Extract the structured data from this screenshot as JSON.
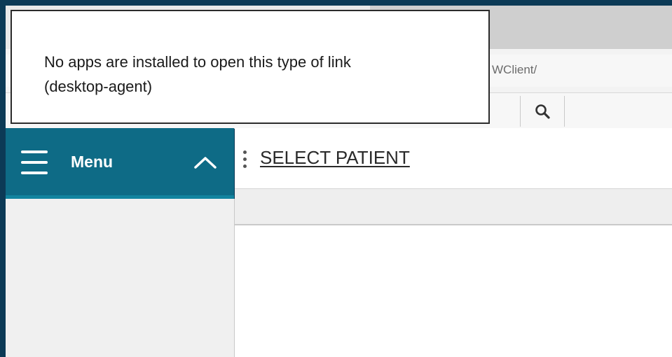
{
  "browser": {
    "url_fragment": "WClient/"
  },
  "toolbar": {
    "search_icon": "search-icon"
  },
  "app": {
    "menu_label": "Menu",
    "menu_icon": "hamburger-icon",
    "collapse_icon": "chevron-up-icon",
    "header_options_icon": "kebab-icon",
    "select_patient_label": "SELECT PATIENT"
  },
  "popup": {
    "line1": "No apps are installed to open this type of link",
    "line2": "(desktop-agent)"
  },
  "colors": {
    "frame": "#0c3a56",
    "menu_bar": "#0e6b86",
    "menu_underline": "#12849f"
  }
}
